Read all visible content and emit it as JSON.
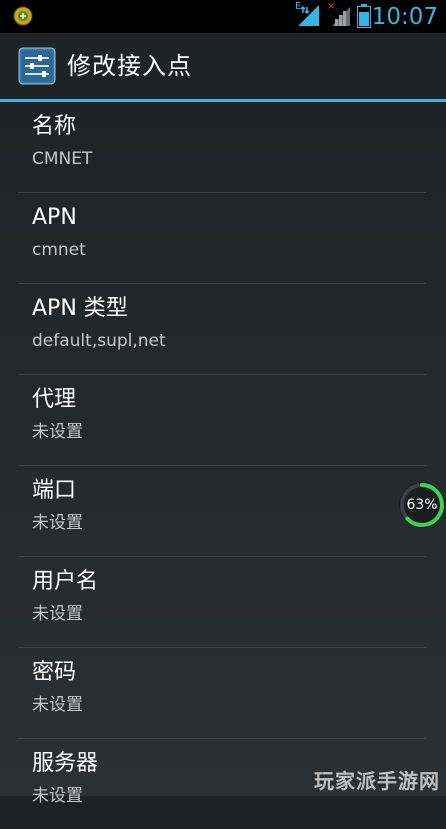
{
  "status_bar": {
    "time": "10:07",
    "net1_tag": "E",
    "net2_tag": "×"
  },
  "action_bar": {
    "title": "修改接入点",
    "icon": "settings-sliders-icon"
  },
  "settings": [
    {
      "title": "名称",
      "summary": "CMNET"
    },
    {
      "title": "APN",
      "summary": "cmnet"
    },
    {
      "title": "APN 类型",
      "summary": "default,supl,net"
    },
    {
      "title": "代理",
      "summary": "未设置"
    },
    {
      "title": "端口",
      "summary": "未设置"
    },
    {
      "title": "用户名",
      "summary": "未设置"
    },
    {
      "title": "密码",
      "summary": "未设置"
    },
    {
      "title": "服务器",
      "summary": "未设置"
    }
  ],
  "progress": {
    "label": "63%",
    "value": 0.63,
    "color": "#39d353"
  },
  "watermark": "玩家派手游网",
  "colors": {
    "accent": "#33b5e5"
  }
}
